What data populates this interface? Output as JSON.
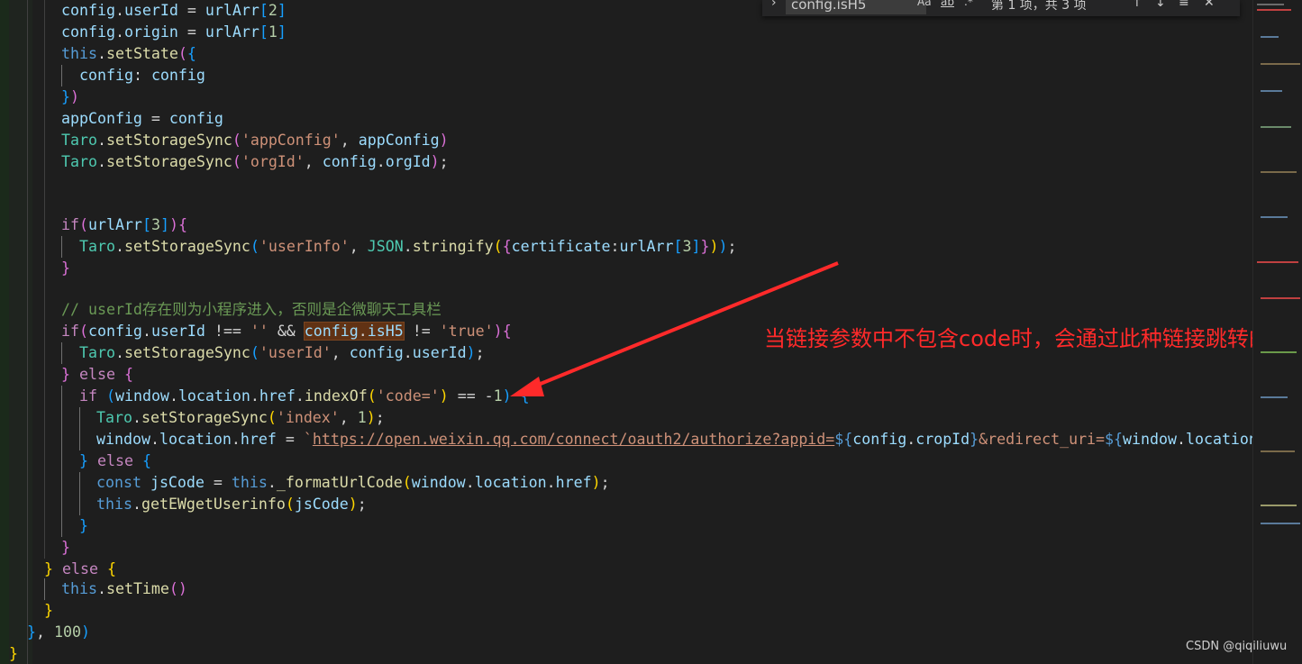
{
  "find_widget": {
    "query": "config.isH5",
    "match_case_label": "Aa",
    "whole_word_label": "ab",
    "regex_label": ".*",
    "result_count": "第 1 项，共 3 项"
  },
  "code_lines": [
    "config.userId = urlArr[2]",
    "config.origin = urlArr[1]",
    "this.setState({",
    "config: config",
    "})",
    "appConfig = config",
    "Taro.setStorageSync('appConfig', appConfig)",
    "Taro.setStorageSync('orgId', config.orgId);",
    "if(urlArr[3]){",
    "Taro.setStorageSync('userInfo', JSON.stringify({certificate:urlArr[3]}));",
    "}",
    "// userId存在则为小程序进入，否则是企微聊天工具栏",
    "if(config.userId !== '' && config.isH5 != 'true'){",
    "Taro.setStorageSync('userId', config.userId);",
    "} else {",
    "if (window.location.href.indexOf('code=') == -1) {",
    "Taro.setStorageSync('index', 1);",
    "window.location.href = `https://open.weixin.qq.com/connect/oauth2/authorize?appid=${config.cropId}&redirect_uri=${window.location.href",
    "} else {",
    "const jsCode = this._formatUrlCode(window.location.href);",
    "this.getEWgetUserinfo(jsCode);",
    "}",
    "}",
    "} else {",
    "this.setTime()",
    "}",
    "}, 100)",
    "}"
  ],
  "annotation": "当链接参数中不包含code时，会通过此种链接跳转的",
  "watermark": "CSDN @qiqiliuwu",
  "colors": {
    "annotation": "#ff2a2a",
    "editor_bg": "#1e1e1e",
    "find_highlight": "#613214"
  }
}
